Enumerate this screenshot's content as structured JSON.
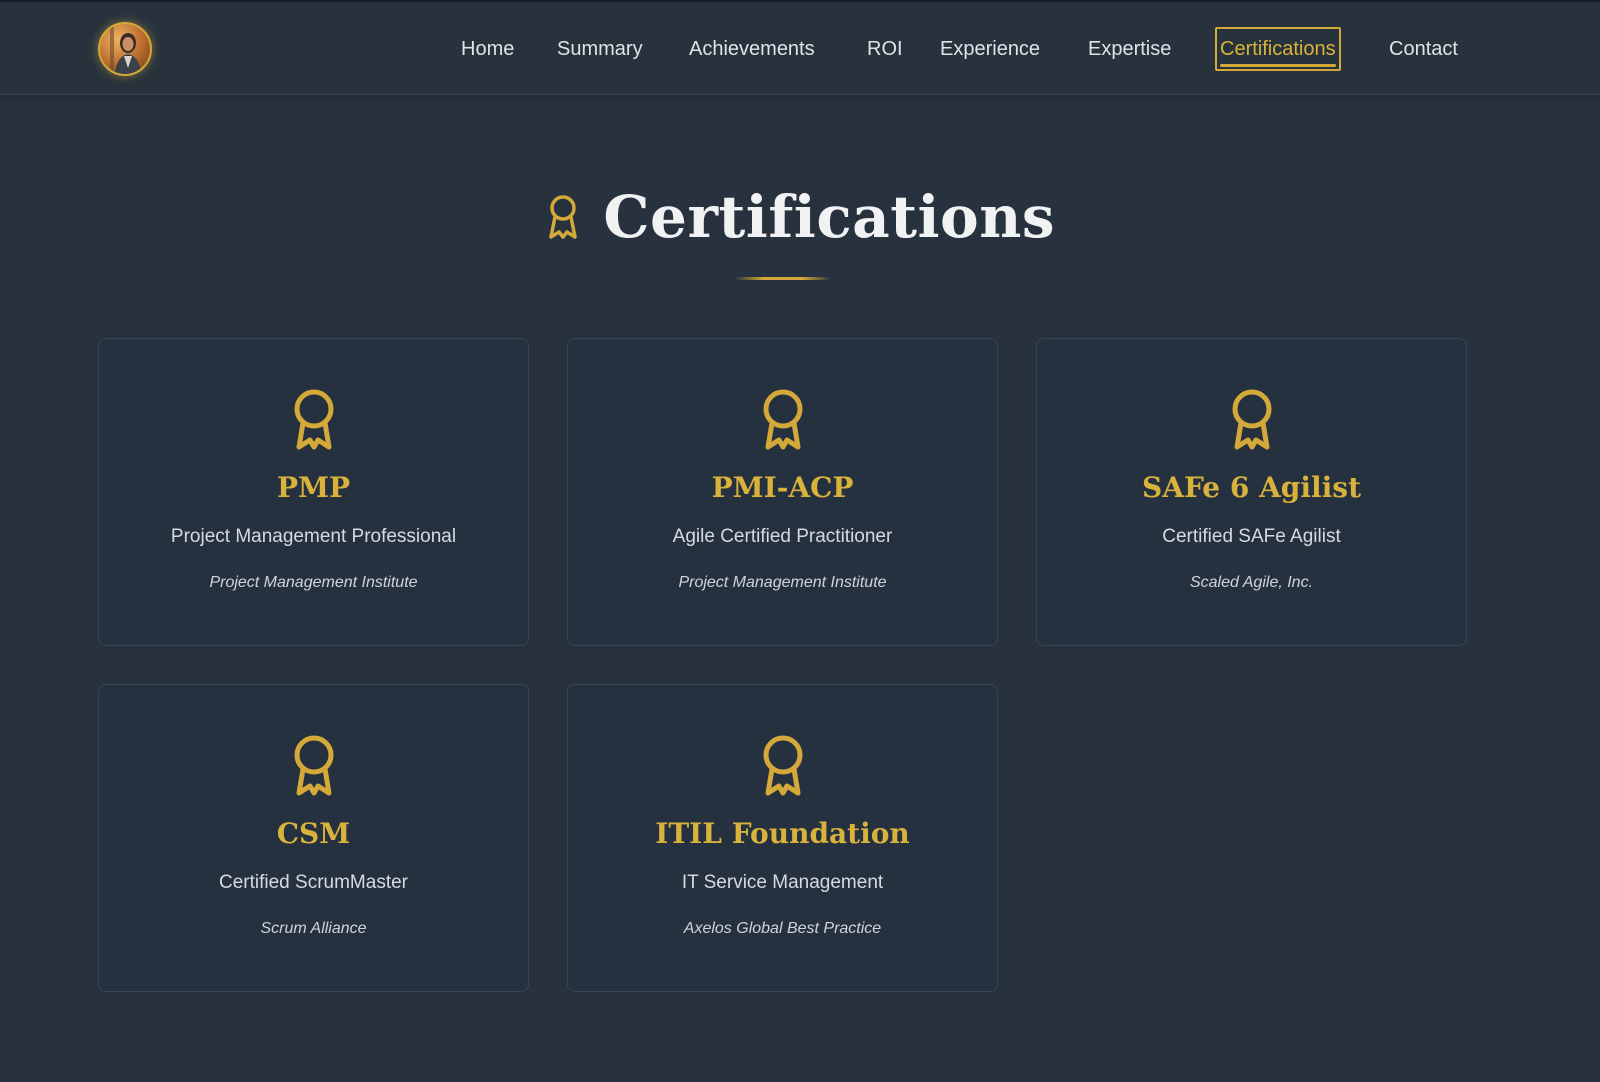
{
  "nav": {
    "items": [
      {
        "label": "Home"
      },
      {
        "label": "Summary"
      },
      {
        "label": "Achievements"
      },
      {
        "label": "ROI"
      },
      {
        "label": "Experience"
      },
      {
        "label": "Expertise"
      },
      {
        "label": "Certifications",
        "active": true
      },
      {
        "label": "Contact"
      }
    ]
  },
  "section": {
    "title": "Certifications",
    "icon": "award-icon"
  },
  "certifications": [
    {
      "title": "PMP",
      "subtitle": "Project Management Professional",
      "issuer": "Project Management Institute",
      "icon": "award-icon"
    },
    {
      "title": "PMI-ACP",
      "subtitle": "Agile Certified Practitioner",
      "issuer": "Project Management Institute",
      "icon": "award-icon"
    },
    {
      "title": "SAFe 6 Agilist",
      "subtitle": "Certified SAFe Agilist",
      "issuer": "Scaled Agile, Inc.",
      "icon": "award-icon"
    },
    {
      "title": "CSM",
      "subtitle": "Certified ScrumMaster",
      "issuer": "Scrum Alliance",
      "icon": "award-icon"
    },
    {
      "title": "ITIL Foundation",
      "subtitle": "IT Service Management",
      "issuer": "Axelos Global Best Practice",
      "icon": "award-icon"
    }
  ],
  "colors": {
    "background": "#27323e",
    "accent": "#d4a93a",
    "card_background": "#263140",
    "text": "#e6e8eb"
  }
}
